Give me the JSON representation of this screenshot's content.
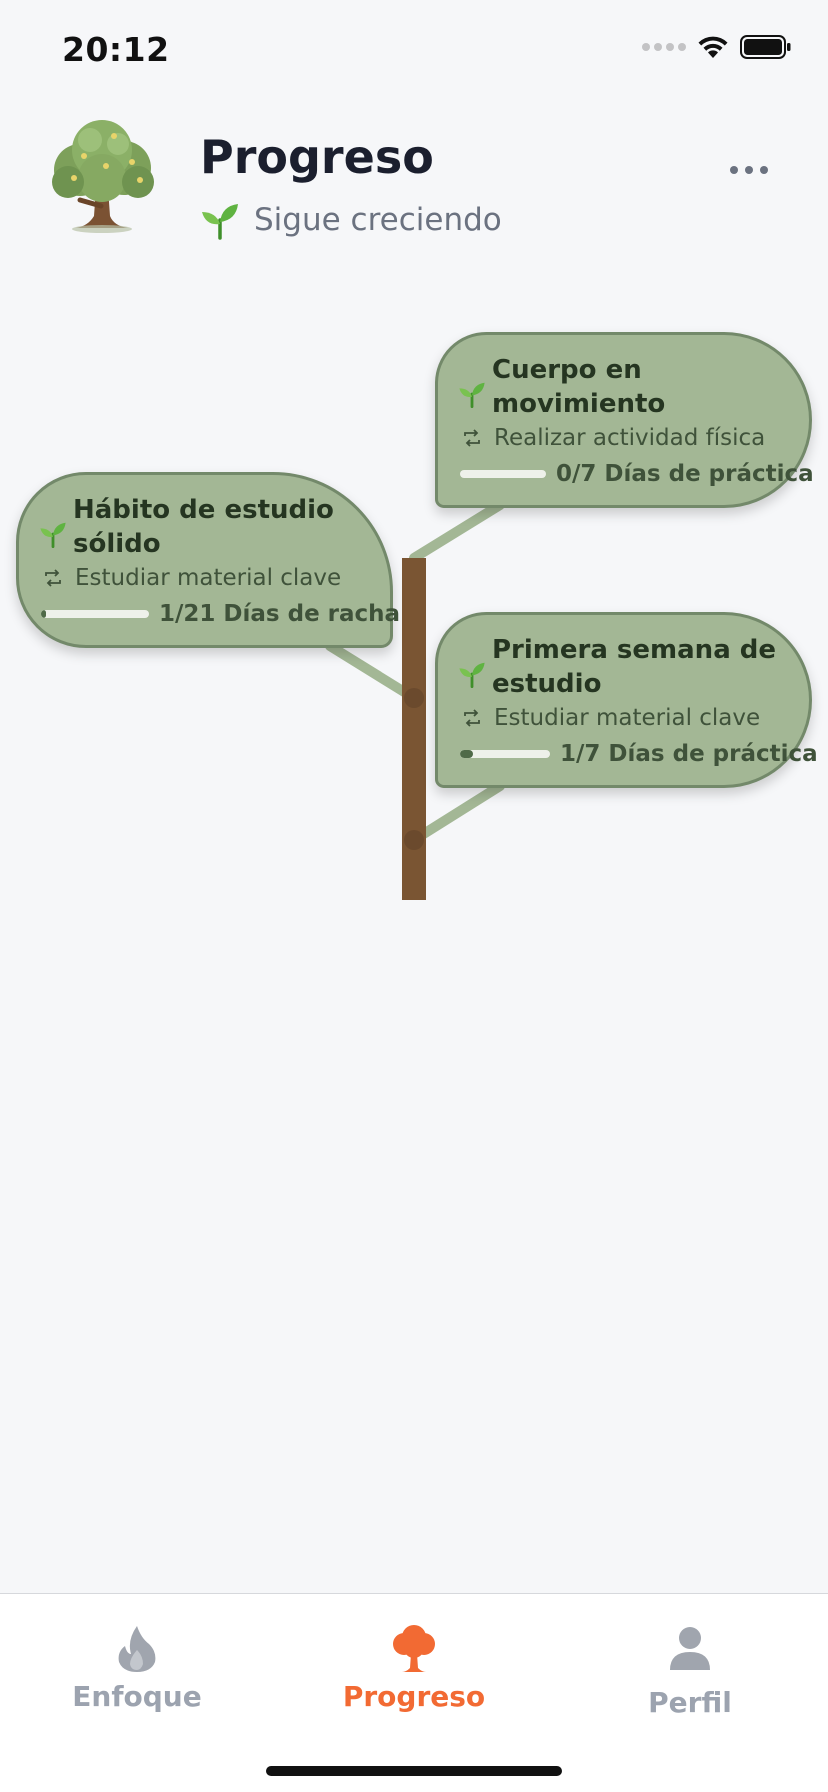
{
  "status_bar": {
    "time": "20:12"
  },
  "header": {
    "title": "Progreso",
    "subtitle": "Sigue creciendo"
  },
  "goals": [
    {
      "title_line1": "Cuerpo en",
      "title_line2": "movimiento",
      "action": "Realizar actividad física",
      "progress_text": "0/7 Días de práctica",
      "progress_fraction": 0.0
    },
    {
      "title_line1": "Hábito de estudio",
      "title_line2": "sólido",
      "action": "Estudiar material clave",
      "progress_text": "1/21 Días de racha",
      "progress_fraction": 0.048
    },
    {
      "title_line1": "Primera semana de",
      "title_line2": "estudio",
      "action": "Estudiar material clave",
      "progress_text": "1/7 Días de práctica",
      "progress_fraction": 0.143
    }
  ],
  "tabs": [
    {
      "label": "Enfoque",
      "icon": "flame-icon",
      "active": false
    },
    {
      "label": "Progreso",
      "icon": "tree-icon",
      "active": true
    },
    {
      "label": "Perfil",
      "icon": "person-icon",
      "active": false
    }
  ],
  "colors": {
    "accent": "#f26a33",
    "card": "#a3b795",
    "trunk": "#7a5533"
  }
}
